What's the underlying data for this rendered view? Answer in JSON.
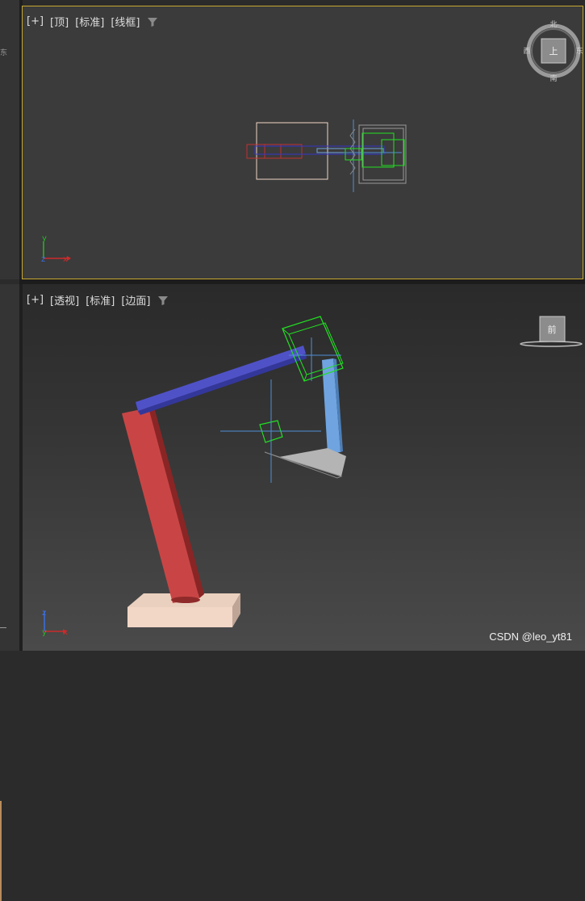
{
  "viewports": {
    "top": {
      "labels": [
        "[+]",
        "[顶]",
        "[标准]",
        "[线框]"
      ],
      "viewcube": {
        "face": "上",
        "north": "北",
        "south": "南",
        "east": "东",
        "west": "西"
      },
      "axes": {
        "a": "y",
        "b": "z",
        "c": "x"
      }
    },
    "perspective": {
      "labels": [
        "[+]",
        "[透视]",
        "[标准]",
        "[边面]"
      ],
      "viewcube": {
        "face": "前"
      },
      "axes": {
        "a": "z",
        "b": "y",
        "c": "x"
      }
    }
  },
  "side": {
    "letter": "东"
  },
  "colors": {
    "active_border": "#c7a72f",
    "base": "#f2d6c6",
    "lower_arm": "#c94545",
    "upper_arm": "#4f52c7",
    "forearm": "#6fa4e0",
    "hand": "#b4b4b4",
    "helper": "#22e022",
    "target": "#4f8fd6"
  },
  "watermark": "CSDN @leo_yt81"
}
